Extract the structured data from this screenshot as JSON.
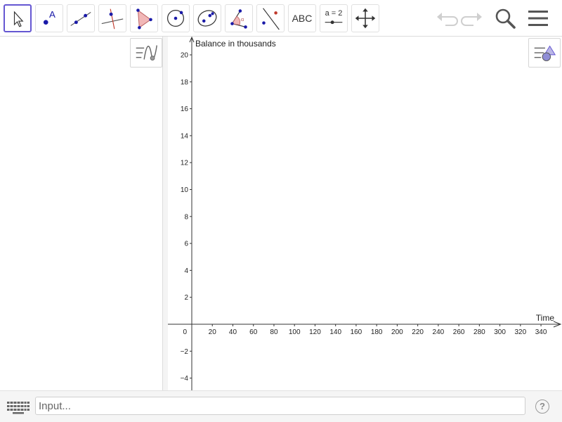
{
  "toolbar": {
    "tools": [
      {
        "name": "move-tool",
        "icon": "arrow-pointer-icon",
        "selected": true
      },
      {
        "name": "point-tool",
        "icon": "point-label-icon",
        "label": "A"
      },
      {
        "name": "line-tool",
        "icon": "line-through-points-icon"
      },
      {
        "name": "perpendicular-tool",
        "icon": "perpendicular-line-icon"
      },
      {
        "name": "polygon-tool",
        "icon": "polygon-icon"
      },
      {
        "name": "circle-tool",
        "icon": "circle-center-point-icon"
      },
      {
        "name": "conic-tool",
        "icon": "ellipse-icon"
      },
      {
        "name": "angle-tool",
        "icon": "angle-icon",
        "label": "α"
      },
      {
        "name": "reflect-tool",
        "icon": "reflect-about-line-icon"
      },
      {
        "name": "text-tool",
        "icon": "text-icon",
        "label": "ABC"
      },
      {
        "name": "slider-tool",
        "icon": "slider-icon",
        "label": "a = 2"
      },
      {
        "name": "move-graphics-tool",
        "icon": "move-arrows-icon"
      }
    ],
    "undo_icon": "undo-icon",
    "redo_icon": "redo-icon",
    "search_icon": "search-icon",
    "menu_icon": "hamburger-menu-icon"
  },
  "algebra_panel": {
    "style_bar_toggle_icon": "algebra-style-toggle-icon"
  },
  "graphics_panel": {
    "style_bar_toggle_icon": "graphics-style-toggle-icon"
  },
  "chart_data": {
    "type": "scatter",
    "title": "",
    "xlabel": "Time",
    "ylabel": "Balance in thousands",
    "xlim": [
      -20,
      360
    ],
    "ylim": [
      -5,
      21
    ],
    "x_ticks": [
      20,
      40,
      60,
      80,
      100,
      120,
      140,
      160,
      180,
      200,
      220,
      240,
      260,
      280,
      300,
      320,
      340
    ],
    "y_ticks": [
      -4,
      -2,
      2,
      4,
      6,
      8,
      10,
      12,
      14,
      16,
      18,
      20
    ],
    "origin_label": "0",
    "grid": false,
    "series": []
  },
  "input_bar": {
    "placeholder": "Input...",
    "keyboard_icon": "keyboard-icon",
    "help_label": "?"
  },
  "colors": {
    "accent": "#6557d2",
    "point": "#1a1aa8",
    "polygon_fill": "#f1b7b7",
    "polygon_edge": "#b85a5a"
  }
}
